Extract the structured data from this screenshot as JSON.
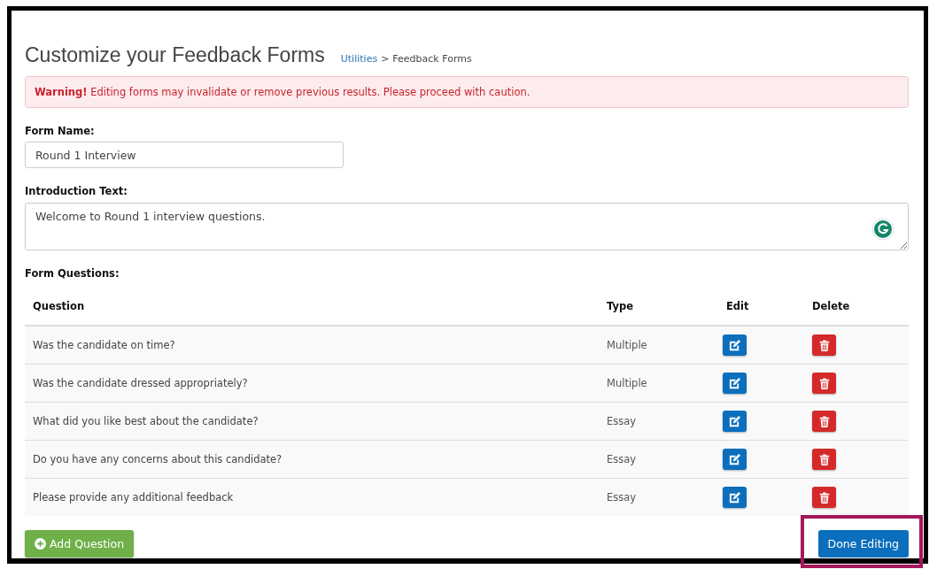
{
  "page": {
    "title": "Customize your Feedback Forms",
    "breadcrumb": {
      "link": "Utilities",
      "separator": ">",
      "current": "Feedback Forms"
    }
  },
  "warning": {
    "text": "**Warning!** Editing forms may invalidate or remove previous results. Please proceed with caution."
  },
  "form_name": {
    "label": "Form Name:",
    "value": "Round 1 Interview"
  },
  "introduction": {
    "label": "Introduction Text:",
    "value": "Welcome to Round 1 interview questions."
  },
  "questions": {
    "label": "Form Questions:",
    "columns": [
      "Question",
      "Type",
      "Edit",
      "Delete"
    ],
    "rows": [
      {
        "question": "Was the candidate on time?",
        "type": "Multiple"
      },
      {
        "question": "Was the candidate dressed appropriately?",
        "type": "Multiple"
      },
      {
        "question": "What did you like best about the candidate?",
        "type": "Essay"
      },
      {
        "question": "Do you have any concerns about this candidate?",
        "type": "Essay"
      },
      {
        "question": "Please provide any additional feedback",
        "type": "Essay"
      }
    ]
  },
  "buttons": {
    "add": "Add Question",
    "done": "Done Editing",
    "done_highlighted": true
  }
}
